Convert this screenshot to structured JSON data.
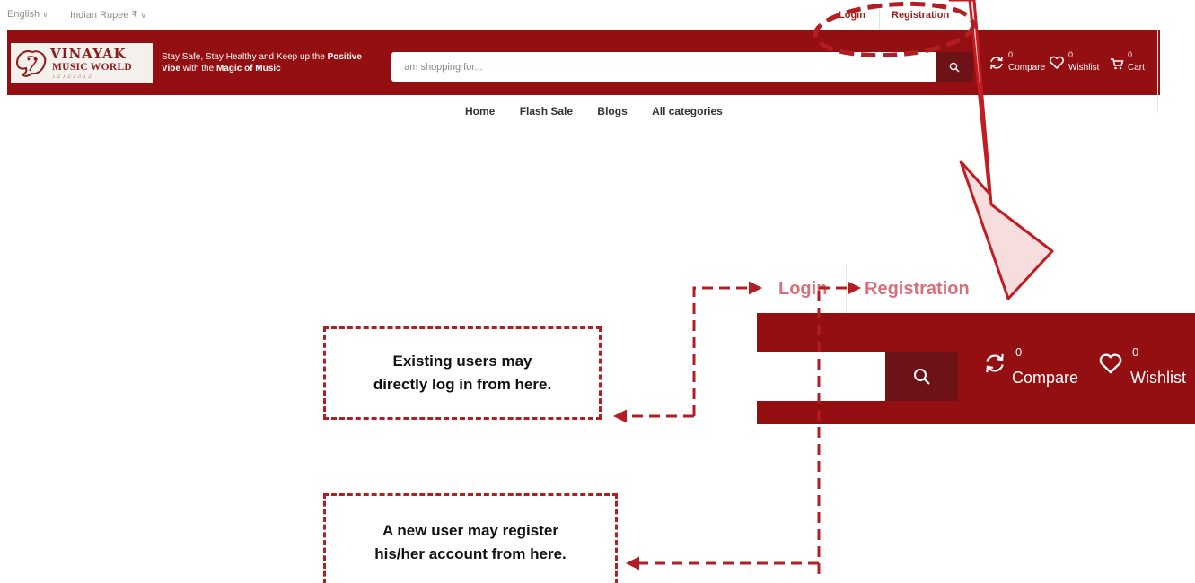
{
  "topbar": {
    "language": "English",
    "currency": "Indian Rupee ₹",
    "login_label": "Login",
    "registration_label": "Registration"
  },
  "header": {
    "logo_line1": "VINAYAK",
    "logo_line2": "MUSIC WORLD",
    "tagline_parts": [
      "Stay Safe, Stay Healthy and Keep up the ",
      "Positive",
      " ",
      "Vibe",
      " with the ",
      "Magic of Music"
    ],
    "search_placeholder": "I am shopping for...",
    "compare_label": "Compare",
    "compare_count": "0",
    "wishlist_label": "Wishlist",
    "wishlist_count": "0",
    "cart_label": "Cart",
    "cart_count": "0"
  },
  "nav": {
    "items": [
      "Home",
      "Flash Sale",
      "Blogs",
      "All categories"
    ]
  },
  "zoom": {
    "login_label": "Login",
    "registration_label": "Registration",
    "compare_label": "Compare",
    "compare_count": "0",
    "wishlist_label": "Wishlist",
    "wishlist_count": "0"
  },
  "annotations": {
    "login_note": [
      "Existing users may",
      "directly log in from here."
    ],
    "register_note": [
      "A new user may register",
      "his/her account from here."
    ]
  },
  "colors": {
    "header_red": "#930f12",
    "search_button": "#6d1216",
    "annotation_red": "#b21e24",
    "zoom_link": "#d6707a"
  }
}
